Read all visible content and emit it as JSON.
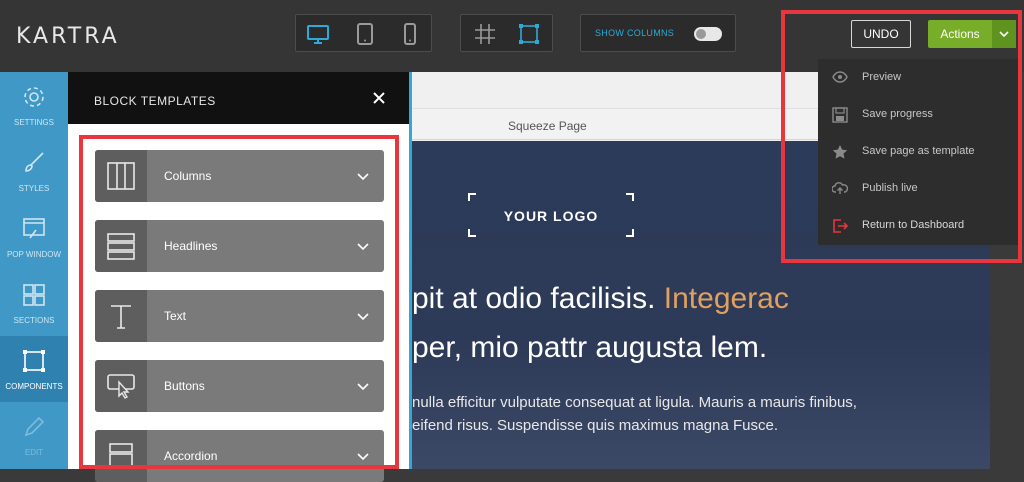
{
  "app": {
    "logo": "KARTRA"
  },
  "toolbar": {
    "device_icons": [
      "desktop-icon",
      "tablet-icon",
      "mobile-icon"
    ],
    "grid_icons": [
      "grid-icon",
      "select-frame-icon"
    ],
    "show_columns_label": "SHOW COLUMNS",
    "show_columns_enabled": false,
    "undo_label": "UNDO",
    "actions_label": "Actions"
  },
  "actions_menu": {
    "items": [
      {
        "label": "Preview",
        "icon": "eye-icon"
      },
      {
        "label": "Save progress",
        "icon": "save-icon"
      },
      {
        "label": "Save page as template",
        "icon": "star-icon"
      },
      {
        "label": "Publish live",
        "icon": "cloud-upload-icon"
      },
      {
        "label": "Return to Dashboard",
        "icon": "exit-icon"
      }
    ]
  },
  "sidebar": {
    "items": [
      {
        "label": "SETTINGS",
        "icon": "gear-icon"
      },
      {
        "label": "STYLES",
        "icon": "brush-icon"
      },
      {
        "label": "POP WINDOW",
        "icon": "popup-icon"
      },
      {
        "label": "SECTIONS",
        "icon": "sections-icon"
      },
      {
        "label": "COMPONENTS",
        "icon": "components-icon",
        "active": true
      },
      {
        "label": "EDIT",
        "icon": "pencil-icon"
      }
    ]
  },
  "block_templates": {
    "title": "BLOCK TEMPLATES",
    "items": [
      {
        "label": "Columns",
        "icon": "columns-icon"
      },
      {
        "label": "Headlines",
        "icon": "headlines-icon"
      },
      {
        "label": "Text",
        "icon": "text-icon"
      },
      {
        "label": "Buttons",
        "icon": "button-click-icon"
      },
      {
        "label": "Accordion",
        "icon": "accordion-icon"
      }
    ]
  },
  "page": {
    "name": "Squeeze Page",
    "logo_placeholder": "YOUR LOGO",
    "headline_line1_a": "pit at odio facilisis. ",
    "headline_line1_b": "Integerac",
    "headline_line2": "per, mio pattr augusta lem.",
    "body_line1": "nulla efficitur vulputate consequat at ligula. Mauris a mauris finibus,",
    "body_line2": "eifend risus. Suspendisse quis maximus magna Fusce."
  },
  "colors": {
    "accent_green": "#78ad2a",
    "sidebar_blue": "#3f98c6",
    "highlight_red": "#e8363f",
    "headline_accent": "#e0a060"
  }
}
